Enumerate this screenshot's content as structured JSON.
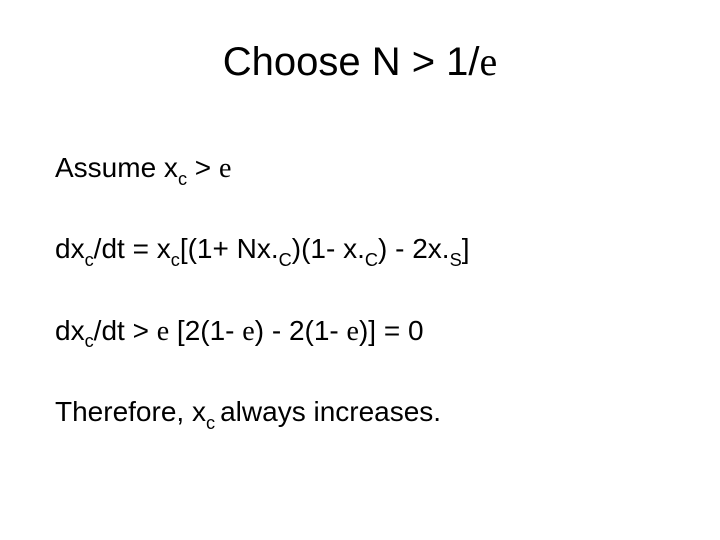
{
  "title": {
    "t1": "Choose N > 1/",
    "eps": "e"
  },
  "lines": {
    "l1": {
      "a": "Assume x",
      "sub1": "c",
      "b": "  > ",
      "eps": "e"
    },
    "l2": {
      "a": "dx",
      "sub1": "c",
      "b": "/dt = x",
      "sub2": "c",
      "c": "[(1+ Nx.",
      "sub3": "C",
      "d": ")(1- x.",
      "sub4": "C",
      "e": ") - 2x.",
      "sub5": "S",
      "f": "]"
    },
    "l3": {
      "a": "dx",
      "sub1": "c",
      "b": "/dt > ",
      "eps1": "e",
      "c": " [2(1- ",
      "eps2": "e",
      "d": ") - 2(1- ",
      "eps3": "e",
      "e": ")] = 0"
    },
    "l4": {
      "a": "Therefore, x",
      "sub1": "c ",
      "b": "always increases."
    }
  }
}
